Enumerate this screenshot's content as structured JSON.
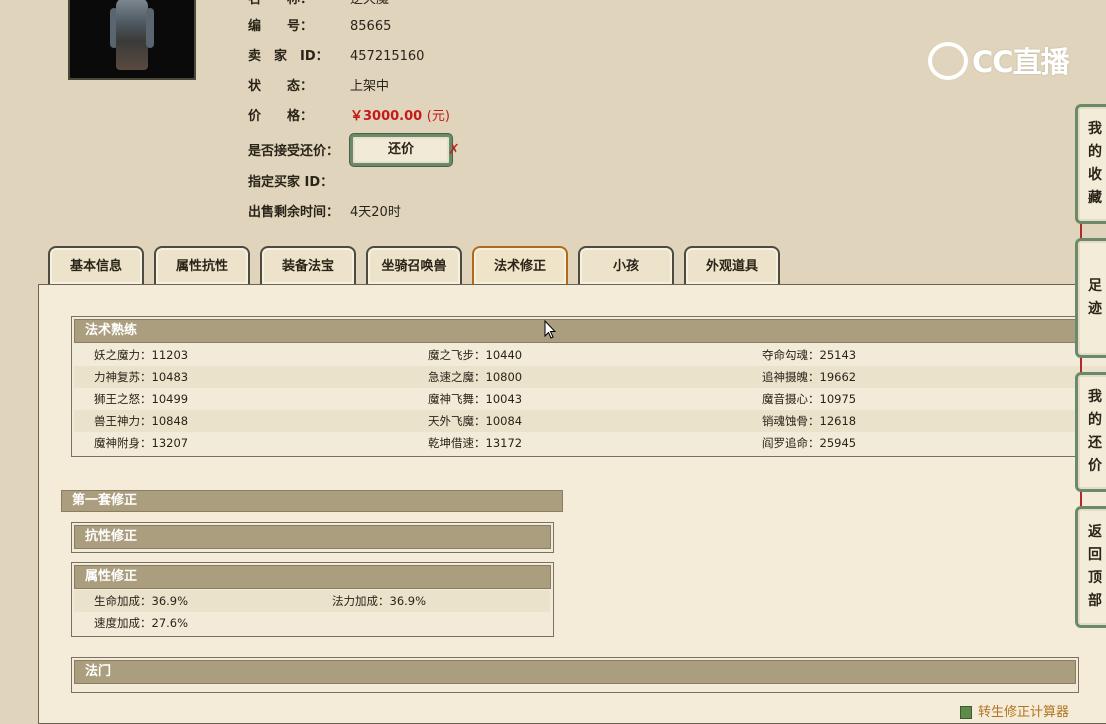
{
  "item": {
    "name_label": "名　　称：",
    "name_value": "逆天魔",
    "number_label": "编　　号：",
    "number_value": "85665",
    "seller_label": "卖　家　ID：",
    "seller_value": "457215160",
    "status_label": "状　　态：",
    "status_value": "上架中",
    "price_label": "价　　格：",
    "price_value": "￥3000.00",
    "price_unit": "(元)",
    "haggle_label": "是否接受还价：",
    "haggle_button": "还价",
    "haggle_mark": "✗",
    "buyer_label": "指定买家 ID：",
    "time_label": "出售剩余时间：",
    "time_value": "4天20时"
  },
  "logo": {
    "text": "CC直播"
  },
  "tabs": [
    {
      "label": "基本信息"
    },
    {
      "label": "属性抗性"
    },
    {
      "label": "装备法宝"
    },
    {
      "label": "坐骑召唤兽"
    },
    {
      "label": "法术修正",
      "active": true
    },
    {
      "label": "小孩"
    },
    {
      "label": "外观道具"
    }
  ],
  "skills": {
    "title": "法术熟练",
    "rows": [
      [
        {
          "name": "妖之魔力：",
          "value": "11203"
        },
        {
          "name": "魔之飞步：",
          "value": "10440"
        },
        {
          "name": "夺命勾魂：",
          "value": "25143"
        }
      ],
      [
        {
          "name": "力神复苏：",
          "value": "10483"
        },
        {
          "name": "急速之魔：",
          "value": "10800"
        },
        {
          "name": "追神摄魄：",
          "value": "19662"
        }
      ],
      [
        {
          "name": "狮王之怒：",
          "value": "10499"
        },
        {
          "name": "魔神飞舞：",
          "value": "10043"
        },
        {
          "name": "魔音摄心：",
          "value": "10975"
        }
      ],
      [
        {
          "name": "兽王神力：",
          "value": "10848"
        },
        {
          "name": "天外飞魔：",
          "value": "10084"
        },
        {
          "name": "销魂蚀骨：",
          "value": "12618"
        }
      ],
      [
        {
          "name": "魔神附身：",
          "value": "13207"
        },
        {
          "name": "乾坤借速：",
          "value": "13172"
        },
        {
          "name": "阎罗追命：",
          "value": "25945"
        }
      ]
    ]
  },
  "set1": {
    "title": "第一套修正",
    "resist_title": "抗性修正",
    "attr_title": "属性修正",
    "attrs": [
      {
        "name": "生命加成：",
        "value": "36.9%"
      },
      {
        "name": "法力加成：",
        "value": "36.9%"
      },
      {
        "name": "速度加成：",
        "value": "27.6%"
      }
    ]
  },
  "fa_men": {
    "title": "法门"
  },
  "side_nav": [
    {
      "label": "我的收藏"
    },
    {
      "label": "足迹"
    },
    {
      "label": "我的还价"
    },
    {
      "label": "返回顶部"
    }
  ],
  "footer": {
    "calculator_link": "转生修正计算器"
  }
}
